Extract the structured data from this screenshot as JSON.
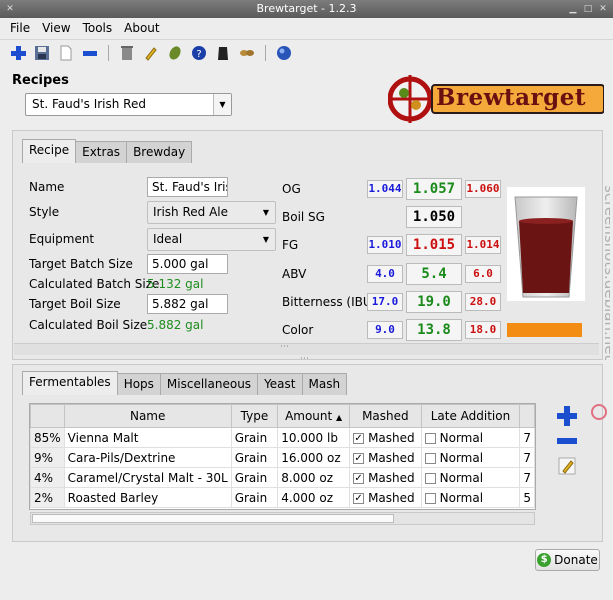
{
  "window": {
    "title": "Brewtarget - 1.2.3"
  },
  "menu": [
    "File",
    "View",
    "Tools",
    "About"
  ],
  "toolbar_icons": [
    "add-icon",
    "save-icon",
    "new-recipe-icon",
    "remove-icon",
    "trash-icon",
    "pencil-icon",
    "hops-icon",
    "help-icon",
    "yeast-icon",
    "grain-icon",
    "globe-icon"
  ],
  "recipes": {
    "label": "Recipes",
    "selected": "St. Faud's Irish Red",
    "logo_text": "Brewtarget"
  },
  "upper_tabs": [
    "Recipe",
    "Extras",
    "Brewday"
  ],
  "recipe_form": {
    "name_label": "Name",
    "name_value": "St. Faud's Irish Red",
    "style_label": "Style",
    "style_value": "Irish Red Ale",
    "equipment_label": "Equipment",
    "equipment_value": "Ideal",
    "batch_label": "Target Batch Size",
    "batch_value": "5.000 gal",
    "calc_batch_label": "Calculated Batch Size",
    "calc_batch_value": "5.132 gal",
    "boil_label": "Target Boil Size",
    "boil_value": "5.882 gal",
    "calc_boil_label": "Calculated Boil Size",
    "calc_boil_value": "5.882 gal"
  },
  "stats": {
    "og": {
      "label": "OG",
      "min": "1.044",
      "value": "1.057",
      "max": "1.060"
    },
    "boil_sg": {
      "label": "Boil SG",
      "value": "1.050"
    },
    "fg": {
      "label": "FG",
      "min": "1.010",
      "value": "1.015",
      "max": "1.014"
    },
    "abv": {
      "label": "ABV",
      "min": "4.0",
      "value": "5.4",
      "max": "6.0"
    },
    "ibu": {
      "label": "Bitterness (IBU)",
      "min": "17.0",
      "value": "19.0",
      "max": "28.0"
    },
    "color": {
      "label": "Color",
      "min": "9.0",
      "value": "13.8",
      "max": "18.0"
    }
  },
  "colors": {
    "beer": "#6b1414",
    "color_bar": "#f28c12",
    "in_range": "#1a8a1a",
    "out_range": "#cc1010",
    "min": "#1a1adb"
  },
  "lower_tabs": [
    "Fermentables",
    "Hops",
    "Miscellaneous",
    "Yeast",
    "Mash"
  ],
  "fermentables": {
    "columns": [
      "",
      "Name",
      "Type",
      "Amount",
      "Mashed",
      "Late Addition",
      ""
    ],
    "rows": [
      {
        "pct": "85%",
        "name": "Vienna Malt",
        "type": "Grain",
        "amount": "10.000 lb",
        "mashed": "Mashed",
        "late": "Normal",
        "extra": "7"
      },
      {
        "pct": "9%",
        "name": "Cara-Pils/Dextrine",
        "type": "Grain",
        "amount": "16.000 oz",
        "mashed": "Mashed",
        "late": "Normal",
        "extra": "7"
      },
      {
        "pct": "4%",
        "name": "Caramel/Crystal Malt - 30L",
        "type": "Grain",
        "amount": "8.000 oz",
        "mashed": "Mashed",
        "late": "Normal",
        "extra": "7"
      },
      {
        "pct": "2%",
        "name": "Roasted Barley",
        "type": "Grain",
        "amount": "4.000 oz",
        "mashed": "Mashed",
        "late": "Normal",
        "extra": "5"
      }
    ]
  },
  "donate_label": "Donate",
  "watermark": "screenshots.debian.net"
}
